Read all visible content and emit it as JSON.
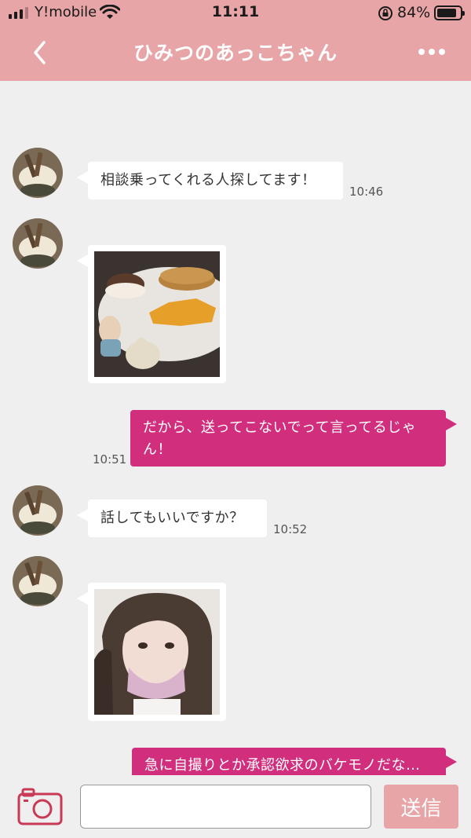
{
  "status_bar": {
    "carrier": "Y!mobile",
    "time": "11:11",
    "battery_pct": "84%",
    "battery_level": 0.84
  },
  "header": {
    "title": "ひみつのあっこちゃん",
    "back_icon": "chevron-left-icon",
    "more_icon": "ellipsis-icon"
  },
  "messages": [
    {
      "side": "in",
      "type": "text",
      "text": "相談乗ってくれる人探してます！",
      "time": "10:46"
    },
    {
      "side": "in",
      "type": "image",
      "image": "pancake-photo"
    },
    {
      "side": "out",
      "type": "text",
      "text": "だから、送ってこないでって言ってるじゃん！",
      "time": "10:51"
    },
    {
      "side": "in",
      "type": "text",
      "text": "話してもいいですか？",
      "time": "10:52"
    },
    {
      "side": "in",
      "type": "image",
      "image": "selfie-photo"
    },
    {
      "side": "out",
      "type": "text",
      "text": "急に自撮りとか承認欲求のバケモノだな…"
    }
  ],
  "composer": {
    "camera_icon": "camera-icon",
    "input_value": "",
    "send_label": "送信"
  },
  "colors": {
    "header": "#e8a5a7",
    "outgoing_bubble": "#d12f7e",
    "background": "#efefef",
    "send_button": "#e8a5a7"
  }
}
